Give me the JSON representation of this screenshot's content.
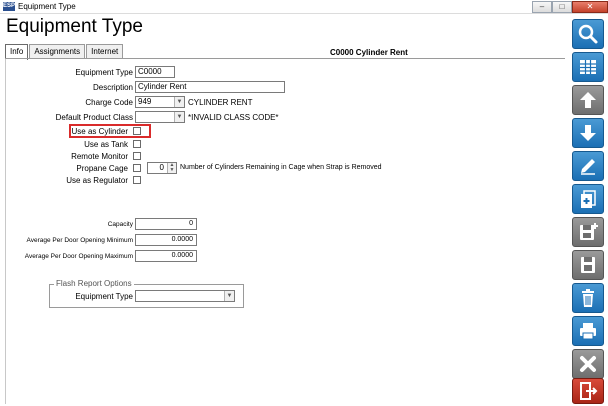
{
  "window": {
    "app_icon_text": "ESP",
    "title": "Equipment Type",
    "minimize": "–",
    "maximize": "□",
    "close": "✕"
  },
  "page": {
    "heading": "Equipment Type",
    "record_header": "C0000   Cylinder Rent"
  },
  "tabs": [
    {
      "label": "Info",
      "active": true
    },
    {
      "label": "Assignments",
      "active": false
    },
    {
      "label": "Internet",
      "active": false
    }
  ],
  "form": {
    "equipment_type_label": "Equipment Type",
    "equipment_type_value": "C0000",
    "description_label": "Description",
    "description_value": "Cylinder Rent",
    "charge_code_label": "Charge Code",
    "charge_code_value": "949",
    "charge_code_desc": "CYLINDER RENT",
    "default_product_class_label": "Default Product Class",
    "default_product_class_value": "",
    "default_product_class_note": "*INVALID CLASS CODE*",
    "use_as_cylinder_label": "Use as Cylinder",
    "use_as_tank_label": "Use as Tank",
    "remote_monitor_label": "Remote Monitor",
    "propane_cage_label": "Propane Cage",
    "cylinders_remaining_value": "0",
    "cylinders_remaining_note": "Number of Cylinders Remaining in Cage when Strap is Removed",
    "use_as_regulator_label": "Use as Regulator",
    "capacity_label": "Capacity",
    "capacity_value": "0",
    "avg_door_min_label": "Average Per Door Opening Minimum",
    "avg_door_min_value": "0.0000",
    "avg_door_max_label": "Average Per Door Opening Maximum",
    "avg_door_max_value": "0.0000"
  },
  "flash_report": {
    "legend": "Flash Report Options",
    "equipment_type_label": "Equipment Type",
    "equipment_type_value": ""
  },
  "sidebar": [
    {
      "name": "search-icon",
      "style": "blue"
    },
    {
      "name": "grid-icon",
      "style": "blue"
    },
    {
      "name": "arrow-up-icon",
      "style": "gray"
    },
    {
      "name": "arrow-down-icon",
      "style": "blue"
    },
    {
      "name": "pencil-icon",
      "style": "blue"
    },
    {
      "name": "copy-add-icon",
      "style": "blue"
    },
    {
      "name": "save-new-icon",
      "style": "gray"
    },
    {
      "name": "save-icon",
      "style": "gray"
    },
    {
      "name": "trash-icon",
      "style": "blue"
    },
    {
      "name": "printer-icon",
      "style": "blue"
    },
    {
      "name": "close-icon",
      "style": "gray"
    },
    {
      "name": "exit-icon",
      "style": "red"
    }
  ],
  "colors": {
    "highlight_box": "#d92b2b",
    "toolbar_blue": "#1b6fb4",
    "toolbar_gray": "#6e6e6e",
    "toolbar_red": "#a92516"
  }
}
